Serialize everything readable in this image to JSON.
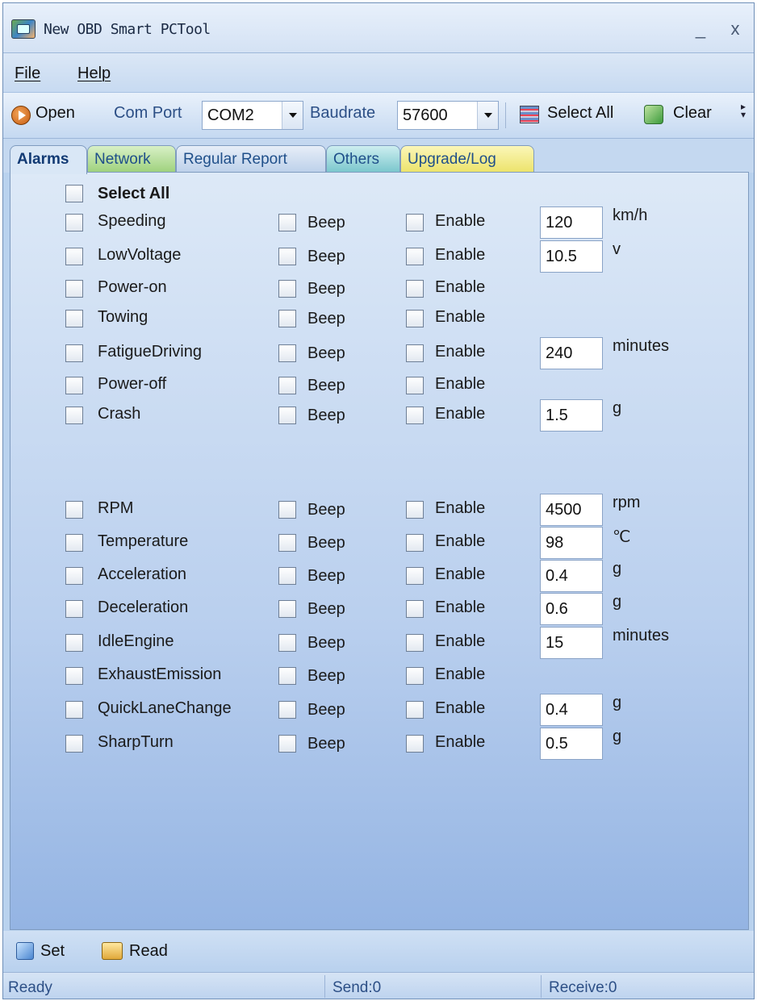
{
  "window": {
    "title": "New OBD Smart PCTool",
    "minimize": "_",
    "close": "x"
  },
  "menu": {
    "file": "File",
    "help": "Help"
  },
  "toolbar": {
    "open": "Open",
    "com_port_label": "Com Port",
    "com_port_value": "COM2",
    "baudrate_label": "Baudrate",
    "baudrate_value": "57600",
    "select_all": "Select All",
    "clear": "Clear"
  },
  "tabs": [
    {
      "label": "Alarms",
      "active": true
    },
    {
      "label": "Network"
    },
    {
      "label": "Regular Report"
    },
    {
      "label": "Others"
    },
    {
      "label": "Upgrade/Log"
    }
  ],
  "alarms": {
    "select_all": "Select All",
    "beep_label": "Beep",
    "enable_label": "Enable",
    "group1": [
      {
        "name": "Speeding",
        "value": "120",
        "unit": "km/h"
      },
      {
        "name": "LowVoltage",
        "value": "10.5",
        "unit": "v"
      },
      {
        "name": "Power-on",
        "value": "",
        "unit": ""
      },
      {
        "name": "Towing",
        "value": "",
        "unit": ""
      },
      {
        "name": "FatigueDriving",
        "value": "240",
        "unit": "minutes"
      },
      {
        "name": "Power-off",
        "value": "",
        "unit": ""
      },
      {
        "name": "Crash",
        "value": "1.5",
        "unit": "g"
      }
    ],
    "group2": [
      {
        "name": "RPM",
        "value": "4500",
        "unit": "rpm"
      },
      {
        "name": "Temperature",
        "value": "98",
        "unit": "℃"
      },
      {
        "name": "Acceleration",
        "value": "0.4",
        "unit": "g"
      },
      {
        "name": "Deceleration",
        "value": "0.6",
        "unit": "g"
      },
      {
        "name": "IdleEngine",
        "value": "15",
        "unit": "minutes"
      },
      {
        "name": "ExhaustEmission",
        "value": "",
        "unit": ""
      },
      {
        "name": "QuickLaneChange",
        "value": "0.4",
        "unit": "g"
      },
      {
        "name": "SharpTurn",
        "value": "0.5",
        "unit": "g"
      }
    ]
  },
  "bottom": {
    "set": "Set",
    "read": "Read"
  },
  "status": {
    "state": "Ready",
    "send": "Send:0",
    "receive": "Receive:0"
  }
}
